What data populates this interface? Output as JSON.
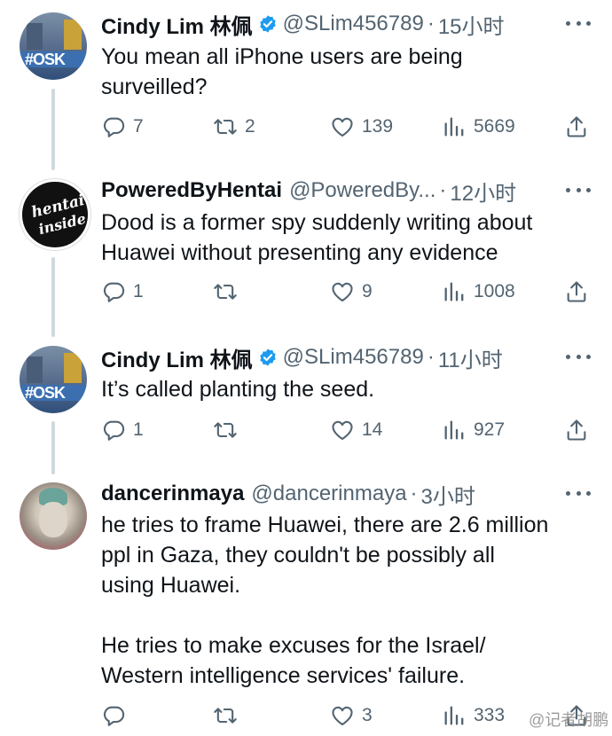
{
  "tweets": [
    {
      "name": "Cindy Lim 林佩",
      "verified": true,
      "handle": "@SLim456789",
      "time": "15小时",
      "text": "You mean all iPhone users are being\nsurveilled?",
      "reply": "7",
      "retweet": "2",
      "like": "139",
      "views": "5669",
      "avatar": "osk-avatar"
    },
    {
      "name": "PoweredByHentai",
      "verified": false,
      "handle": "@PoweredBy...",
      "time": "12小时",
      "text": "Dood is a former spy suddenly writing about\nHuawei without presenting any evidence",
      "reply": "1",
      "retweet": "",
      "like": "9",
      "views": "1008",
      "avatar": "hentai-inside-avatar",
      "avatar_text_1": "hentai",
      "avatar_text_2": "inside"
    },
    {
      "name": "Cindy Lim 林佩",
      "verified": true,
      "handle": "@SLim456789",
      "time": "11小时",
      "text": "It’s called planting the seed.",
      "reply": "1",
      "retweet": "",
      "like": "14",
      "views": "927",
      "avatar": "osk-avatar"
    },
    {
      "name": "dancerinmaya",
      "verified": false,
      "handle": "@dancerinmaya",
      "time": "3小时",
      "text": "he tries to frame Huawei, there are 2.6 million\nppl in Gaza, they couldn't be possibly all\nusing Huawei.\n\nHe tries to make excuses for the Israel/\nWestern intelligence services' failure.",
      "reply": "",
      "retweet": "",
      "like": "3",
      "views": "333",
      "avatar": "buddha-avatar"
    }
  ],
  "dot": "·",
  "osk_text": "#OSK",
  "watermark": "@记者胡鹏",
  "colors": {
    "text": "#0f1419",
    "muted": "#536471",
    "verified": "#1d9bf0",
    "line": "#cfd9de"
  }
}
